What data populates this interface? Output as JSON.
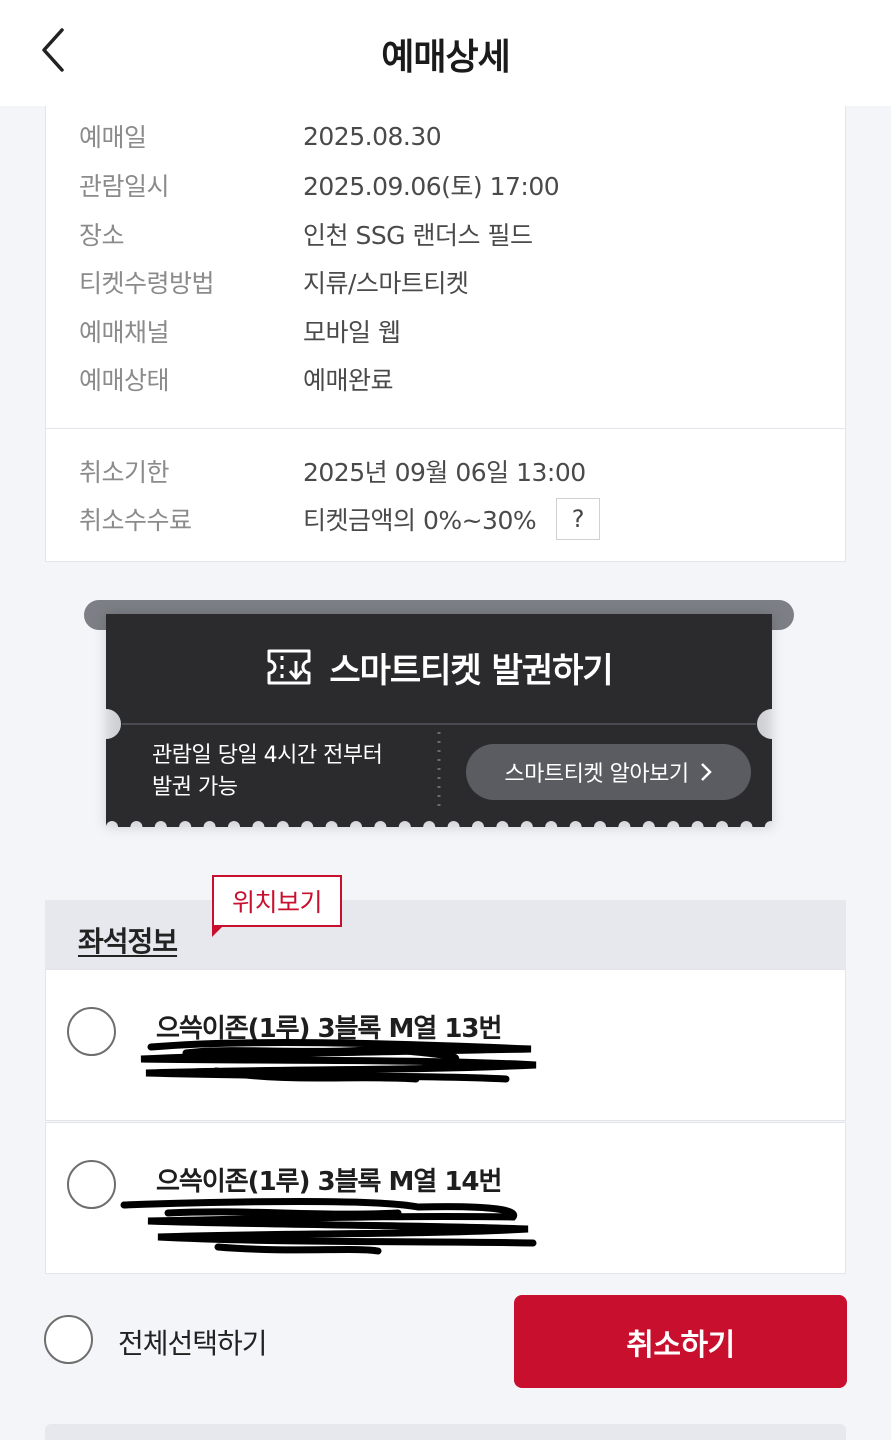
{
  "header": {
    "title": "예매상세",
    "back_icon": "chevron-left-icon"
  },
  "booking_info": {
    "rows": [
      {
        "label": "예매일",
        "value": "2025.08.30"
      },
      {
        "label": "관람일시",
        "value": "2025.09.06(토) 17:00"
      },
      {
        "label": "장소",
        "value": "인천 SSG 랜더스 필드"
      },
      {
        "label": "티켓수령방법",
        "value": "지류/스마트티켓"
      },
      {
        "label": "예매채널",
        "value": "모바일 웹"
      },
      {
        "label": "예매상태",
        "value": "예매완료"
      }
    ]
  },
  "cancel_info": {
    "deadline_label": "취소기한",
    "deadline_value": "2025년 09월 06일 13:00",
    "fee_label": "취소수수료",
    "fee_value": "티켓금액의 0%~30%",
    "help_label": "?"
  },
  "smart_ticket": {
    "title": "스마트티켓 발권하기",
    "icon": "ticket-download-icon",
    "note": "관람일 당일 4시간 전부터 발권 가능",
    "note_line1": "관람일 당일 4시간 전부터",
    "note_line2": "발권 가능",
    "learn_more": "스마트티켓 알아보기",
    "learn_more_icon": "chevron-right-icon"
  },
  "seat_section": {
    "title": "좌석정보",
    "location_tooltip": "위치보기",
    "seats": [
      {
        "label": "으쓱이존(1루) 3블록 M열 13번",
        "checked": false
      },
      {
        "label": "으쓱이존(1루) 3블록 M열 14번",
        "checked": false
      }
    ]
  },
  "actions": {
    "select_all": "전체선택하기",
    "cancel": "취소하기"
  },
  "colors": {
    "accent": "#c8102e",
    "ticket_bg": "#2b2b2d",
    "page_bg": "#f4f5f9"
  }
}
